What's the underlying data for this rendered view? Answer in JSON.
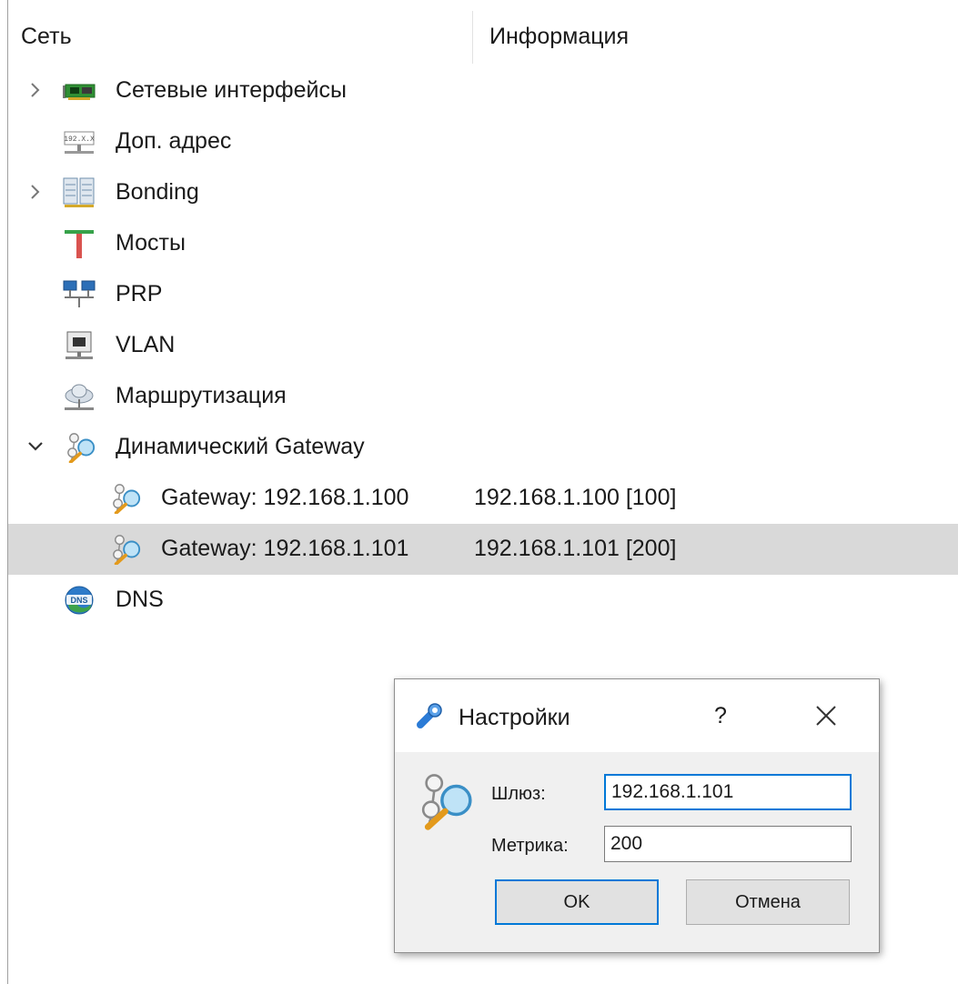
{
  "header": {
    "col_network": "Сеть",
    "col_info": "Информация"
  },
  "tree": {
    "interfaces": {
      "label": "Сетевые интерфейсы",
      "icon": "network-card-icon"
    },
    "extra_address": {
      "label": "Доп. адрес",
      "icon": "ip-address-icon"
    },
    "bonding": {
      "label": "Bonding",
      "icon": "bonding-icon"
    },
    "bridges": {
      "label": "Мосты",
      "icon": "bridge-icon"
    },
    "prp": {
      "label": "PRP",
      "icon": "prp-network-icon"
    },
    "vlan": {
      "label": "VLAN",
      "icon": "vlan-icon"
    },
    "routing": {
      "label": "Маршрутизация",
      "icon": "routing-cloud-icon"
    },
    "dynamic_gateway": {
      "label": "Динамический Gateway",
      "icon": "gateway-search-icon",
      "children": [
        {
          "label": "Gateway: 192.168.1.100",
          "info": "192.168.1.100 [100]"
        },
        {
          "label": "Gateway: 192.168.1.101",
          "info": "192.168.1.101 [200]"
        }
      ]
    },
    "dns": {
      "label": "DNS",
      "icon": "dns-globe-icon"
    }
  },
  "dialog": {
    "title": "Настройки",
    "help": "?",
    "gateway_label": "Шлюз:",
    "gateway_value": "192.168.1.101",
    "metric_label": "Метрика:",
    "metric_value": "200",
    "ok_label": "OK",
    "cancel_label": "Отмена"
  },
  "colors": {
    "selection": "#d9d9d9",
    "focus": "#0078d7",
    "dialog_bg": "#f0f0f0"
  }
}
